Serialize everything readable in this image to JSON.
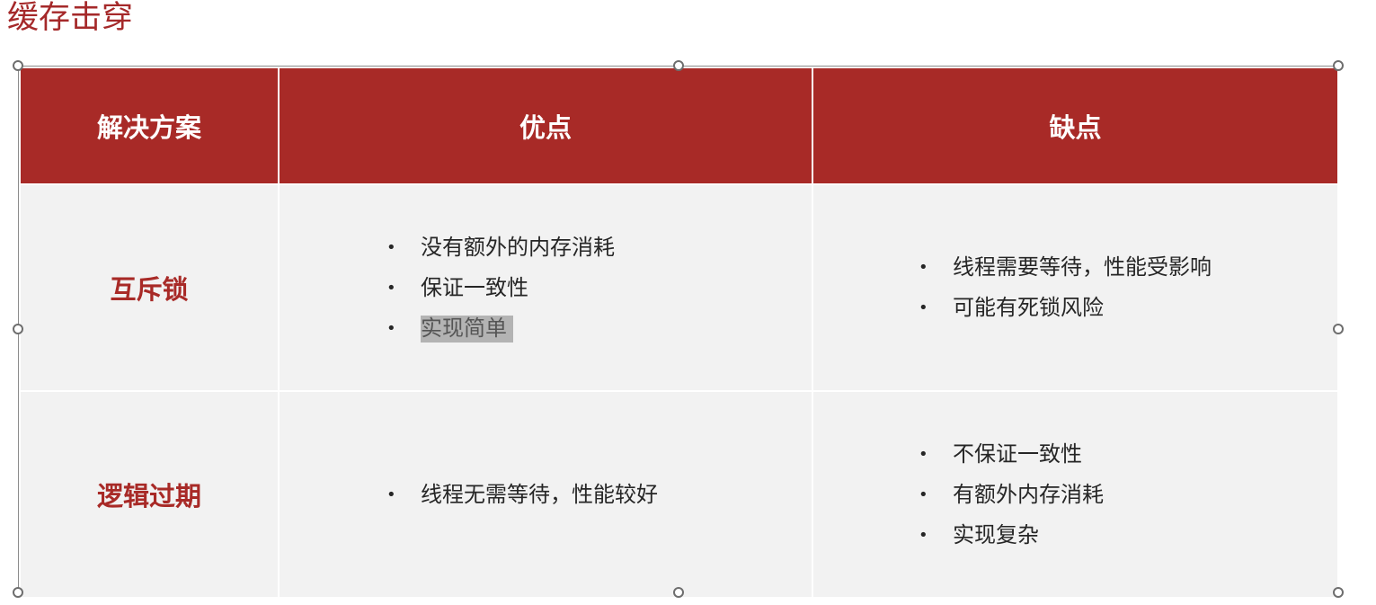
{
  "slide": {
    "title": "缓存击穿"
  },
  "table": {
    "headers": {
      "solution": "解决方案",
      "pros": "优点",
      "cons": "缺点"
    },
    "rows": [
      {
        "name": "互斥锁",
        "pros": [
          "没有额外的内存消耗",
          "保证一致性",
          "实现简单"
        ],
        "cons": [
          "线程需要等待，性能受影响",
          "可能有死锁风险"
        ]
      },
      {
        "name": "逻辑过期",
        "pros": [
          "线程无需等待，性能较好"
        ],
        "cons": [
          "不保证一致性",
          "有额外内存消耗",
          "实现复杂"
        ]
      }
    ],
    "bullet_glyph": "•",
    "selected_text": "实现简单"
  },
  "colors": {
    "accent": "#a82a27",
    "cell_bg": "#f2f2f2",
    "header_text": "#ffffff",
    "body_text": "#262626",
    "selection_highlight": "#b3b3b3"
  }
}
